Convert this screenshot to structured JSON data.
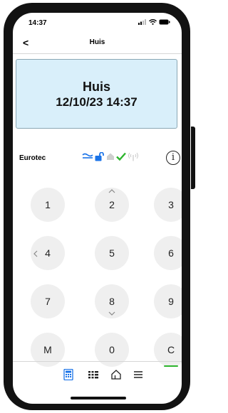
{
  "status_bar": {
    "time": "14:37"
  },
  "nav": {
    "back_label": "<",
    "title": "Huis"
  },
  "display": {
    "line1": "Huis",
    "line2": "12/10/23  14:37"
  },
  "alarm_status": {
    "brand": "Eurotec",
    "icons": [
      "mains-power-icon",
      "unlocked-icon",
      "home-grey-icon",
      "check-icon",
      "signal-tower-icon"
    ],
    "info_label": "i"
  },
  "keypad": {
    "keys": [
      "1",
      "2",
      "3",
      "4",
      "5",
      "6",
      "7",
      "8",
      "9",
      "M",
      "0",
      "C"
    ]
  },
  "tabbar": {
    "tabs": [
      "keypad-tab",
      "grid-tab",
      "home-tab",
      "menu-tab"
    ],
    "active": "keypad-tab"
  },
  "colors": {
    "accent": "#1a73e8",
    "green": "#2db52d",
    "lcd_bg": "#d9effa"
  }
}
